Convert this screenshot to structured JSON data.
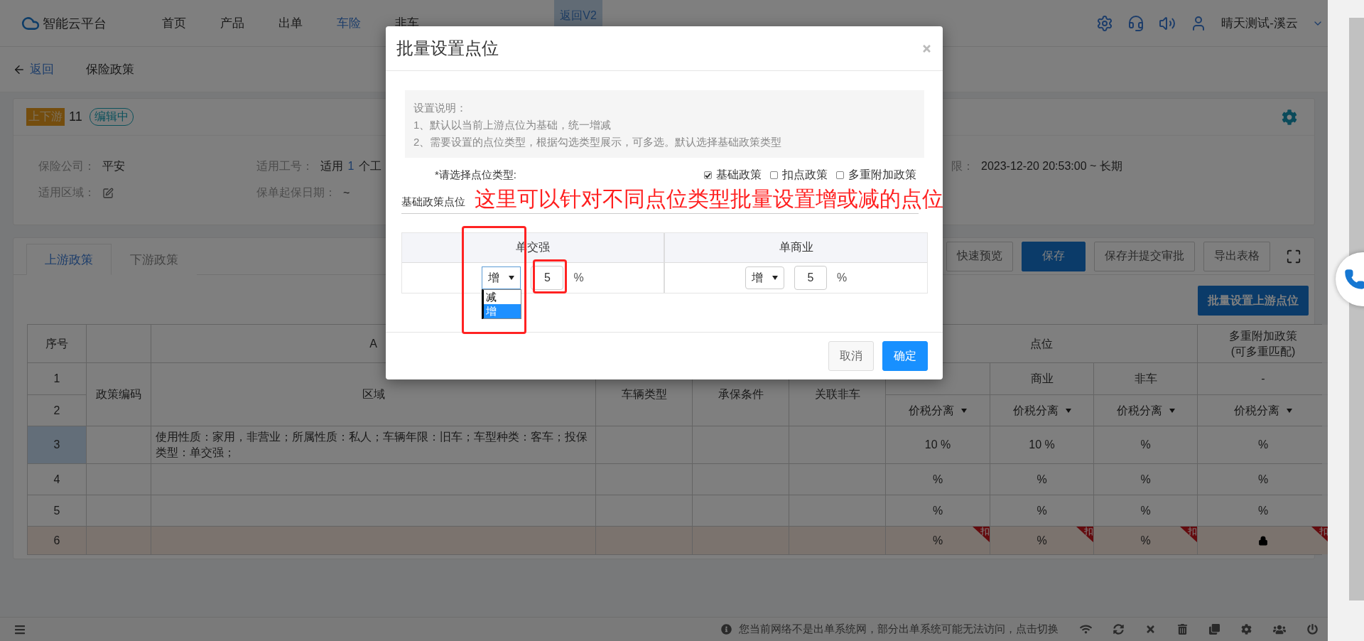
{
  "nav": {
    "logo": "智能云平台",
    "items": [
      {
        "label": "首页",
        "selected": false
      },
      {
        "label": "产品",
        "selected": false
      },
      {
        "label": "出单",
        "selected": false
      },
      {
        "label": "车险",
        "selected": true
      },
      {
        "label": "非车",
        "selected": false
      }
    ],
    "v2_button": "返回V2",
    "user": "晴天测试-溪云"
  },
  "breadcrumb": {
    "back": "返回",
    "title": "保险政策"
  },
  "policy": {
    "badge": "上下游",
    "number": "11",
    "status": "编辑中",
    "rows": [
      [
        {
          "kind": "text",
          "label": "保险公司：",
          "value": "平安"
        },
        {
          "kind": "count",
          "label": "适用工号：",
          "prefix": "适用",
          "count": "1",
          "suffix": "个工"
        },
        {
          "kind": "text",
          "label": "限：",
          "value": "2023-12-20 20:53:00 ~ 长期"
        }
      ],
      [
        {
          "kind": "edit",
          "label": "适用区域："
        },
        {
          "kind": "text",
          "label": "保单起保日期：",
          "value": "~"
        }
      ]
    ]
  },
  "tabs": [
    {
      "label": "上游政策",
      "selected": true
    },
    {
      "label": "下游政策",
      "selected": false
    }
  ],
  "toolbar": [
    {
      "label": "快速预览",
      "kind": "default"
    },
    {
      "label": "保存",
      "kind": "primary"
    },
    {
      "label": "保存并提交审批",
      "kind": "default"
    },
    {
      "label": "导出表格",
      "kind": "default"
    }
  ],
  "batch_button": "批量设置上游点位",
  "table": {
    "row_header": "序号",
    "column_letter": "A",
    "point_group": "点位",
    "multi_header": [
      "多重附加政策",
      "(可多重匹配)"
    ],
    "columns": [
      "政策编码",
      "区域",
      "车辆类型",
      "承保条件",
      "关联非车"
    ],
    "point_columns": [
      {
        "tax": "价税分离"
      },
      {
        "label": "商业",
        "tax": "价税分离"
      },
      {
        "label": "非车",
        "tax": "价税分离"
      },
      {
        "label": "-",
        "tax": "价税分离"
      }
    ],
    "row_numbers": [
      {
        "label": "1",
        "selected": false
      },
      {
        "label": "2",
        "selected": false
      }
    ],
    "rows": [
      {
        "number": "3",
        "selected": true,
        "flagged": false,
        "region": "使用性质：家用，非营业；所属性质：私人；车辆年限：旧车；车型种类：客车；投保类型：单交强；",
        "points": [
          {
            "kind": "text",
            "text": "10 %"
          },
          {
            "kind": "text",
            "text": "10 %"
          },
          {
            "kind": "text",
            "text": "%"
          },
          {
            "kind": "text",
            "text": "%"
          }
        ]
      },
      {
        "number": "4",
        "selected": false,
        "flagged": false,
        "points": [
          {
            "kind": "text",
            "text": "%"
          },
          {
            "kind": "text",
            "text": "%"
          },
          {
            "kind": "text",
            "text": "%"
          },
          {
            "kind": "text",
            "text": "%"
          }
        ]
      },
      {
        "number": "5",
        "selected": false,
        "flagged": false,
        "points": [
          {
            "kind": "text",
            "text": "%"
          },
          {
            "kind": "text",
            "text": "%"
          },
          {
            "kind": "text",
            "text": "%"
          },
          {
            "kind": "text",
            "text": "%"
          }
        ]
      },
      {
        "number": "6",
        "selected": false,
        "flagged": true,
        "points": [
          {
            "kind": "text",
            "text": "%",
            "tag": "扣"
          },
          {
            "kind": "text",
            "text": "%",
            "tag": "扣"
          },
          {
            "kind": "text",
            "text": "%",
            "tag": "扣"
          },
          {
            "kind": "lock",
            "tag": "扣"
          }
        ]
      }
    ]
  },
  "modal": {
    "title": "批量设置点位",
    "notes": [
      "设置说明：",
      "1、默认以当前上游点位为基础，统一增减",
      "2、需要设置的点位类型，根据勾选类型展示，可多选。默认选择基础政策类型"
    ],
    "type_label": "*请选择点位类型:",
    "types": [
      {
        "label": "基础政策",
        "checked": true
      },
      {
        "label": "扣点政策",
        "checked": false
      },
      {
        "label": "多重附加政策",
        "checked": false
      }
    ],
    "section": "基础政策点位",
    "columns": [
      {
        "label": "单交强",
        "direction": "增",
        "value": "5",
        "unit": "%",
        "open": true,
        "options": [
          {
            "label": "减",
            "selected": false
          },
          {
            "label": "增",
            "selected": true
          }
        ]
      },
      {
        "label": "单商业",
        "direction": "增",
        "value": "5",
        "unit": "%",
        "open": false
      }
    ],
    "buttons": [
      {
        "label": "取消",
        "kind": "default"
      },
      {
        "label": "确定",
        "kind": "primary"
      }
    ]
  },
  "annotation": "这里可以针对不同点位类型批量设置增或减的点位",
  "status_bar": {
    "message": "您当前网络不是出单系统网，部分出单系统可能无法访问，点击切换"
  }
}
